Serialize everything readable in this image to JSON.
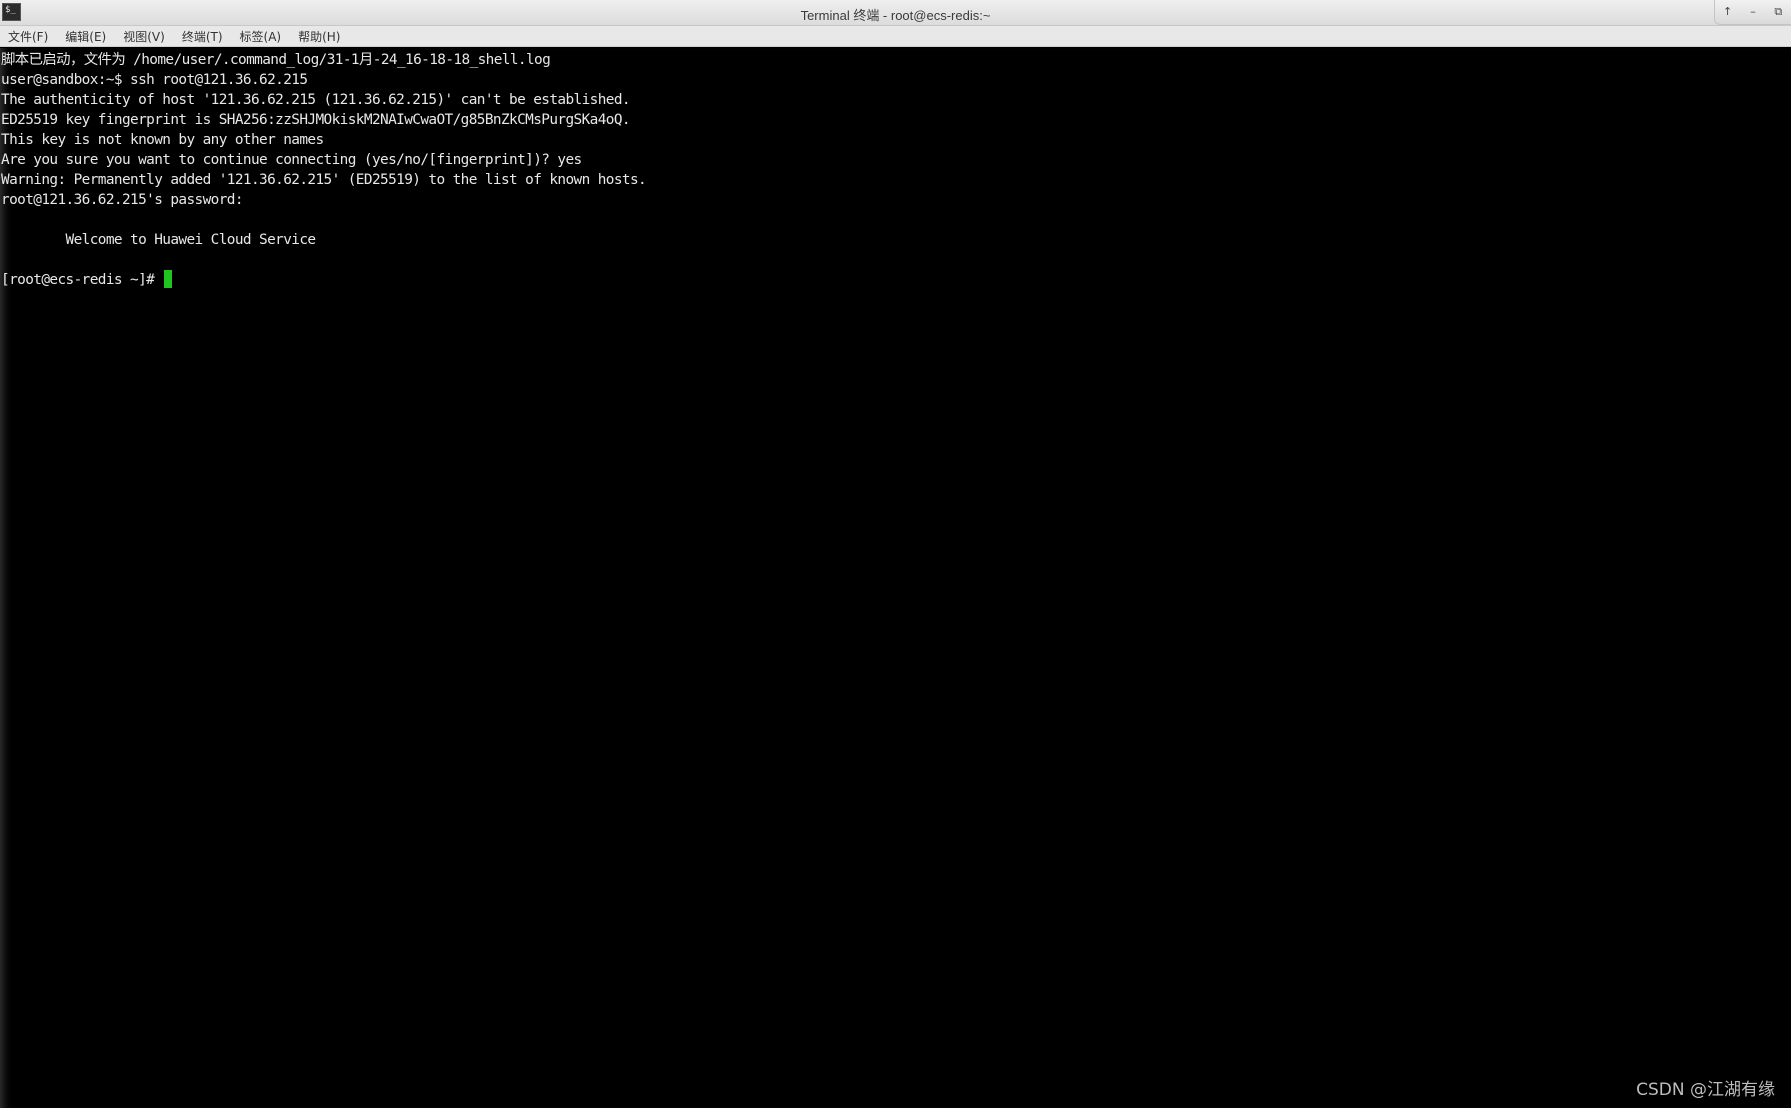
{
  "window": {
    "title": "Terminal 终端 - root@ecs-redis:~",
    "icon": "terminal-icon",
    "icon_glyph": "$_",
    "controls": [
      {
        "name": "maximize-up-icon",
        "glyph": "↑"
      },
      {
        "name": "minimize-icon",
        "glyph": "–"
      },
      {
        "name": "restore-icon",
        "glyph": "⧉"
      }
    ]
  },
  "menu": [
    "文件(F)",
    "编辑(E)",
    "视图(V)",
    "终端(T)",
    "标签(A)",
    "帮助(H)"
  ],
  "terminal": {
    "lines": [
      "脚本已启动，文件为 /home/user/.command_log/31-1月-24_16-18-18_shell.log",
      "user@sandbox:~$ ssh root@121.36.62.215",
      "The authenticity of host '121.36.62.215 (121.36.62.215)' can't be established.",
      "ED25519 key fingerprint is SHA256:zzSHJMOkiskM2NAIwCwaOT/g85BnZkCMsPurgSKa4oQ.",
      "This key is not known by any other names",
      "Are you sure you want to continue connecting (yes/no/[fingerprint])? yes",
      "Warning: Permanently added '121.36.62.215' (ED25519) to the list of known hosts.",
      "root@121.36.62.215's password:",
      "",
      "        Welcome to Huawei Cloud Service",
      ""
    ],
    "prompt": "[root@ecs-redis ~]# ",
    "colors": {
      "background": "#000000",
      "foreground": "#e8e8e8",
      "cursor": "#1fc41f"
    }
  },
  "watermark": "CSDN @江湖有缘"
}
